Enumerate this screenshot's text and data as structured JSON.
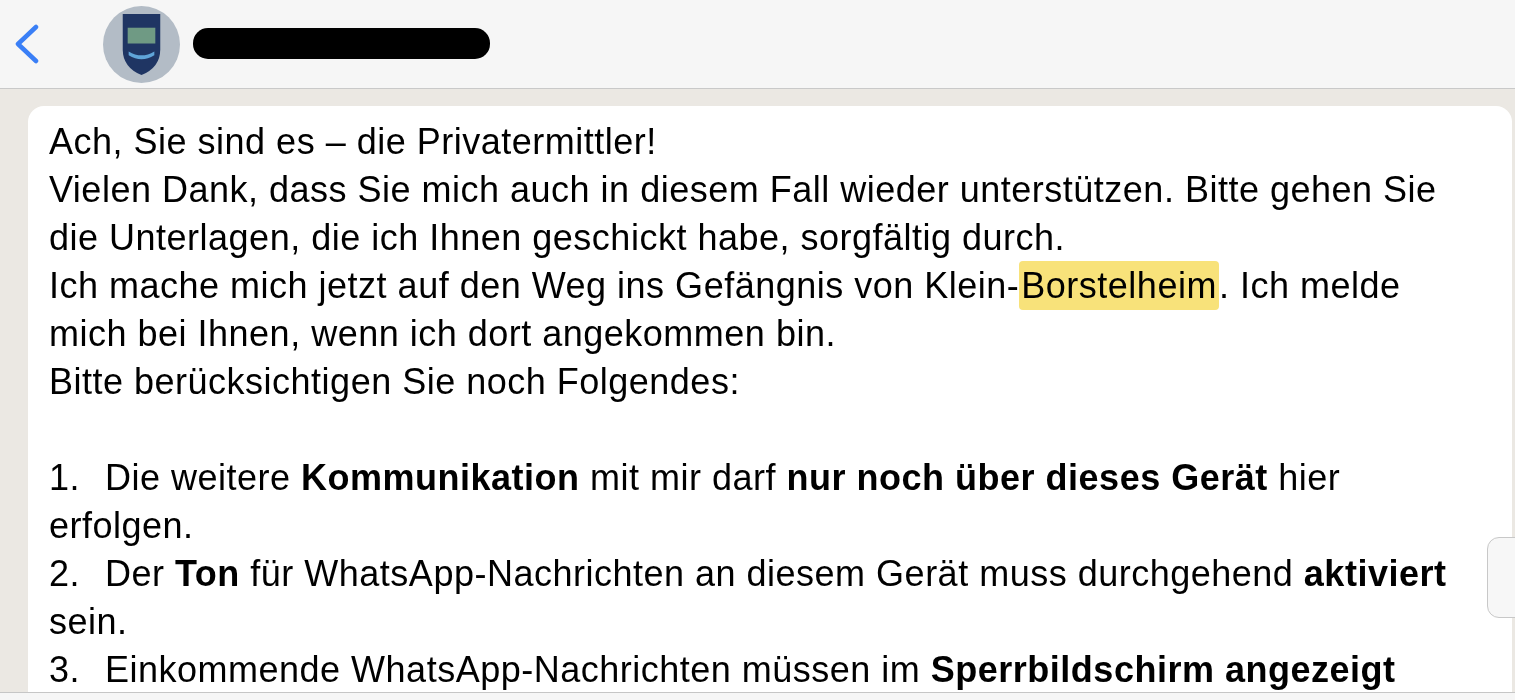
{
  "header": {
    "contact_name": {
      "redacted": true
    }
  },
  "message": {
    "paragraphs": [
      {
        "segments": [
          {
            "text": "Ach, Sie sind es – die Privatermittler!",
            "highlighted": false
          }
        ]
      },
      {
        "segments": [
          {
            "text": "Vielen Dank, dass Sie mich auch in diesem Fall wieder unterstützen. Bitte gehen Sie die Unterlagen, die ich Ihnen geschickt habe, sorgfältig durch.",
            "highlighted": false
          }
        ]
      },
      {
        "segments": [
          {
            "text": "Ich mache mich jetzt auf den Weg ins Gefängnis von Klein-",
            "highlighted": false
          },
          {
            "text": "Borstelheim",
            "highlighted": true
          },
          {
            "text": ". Ich melde mich bei Ihnen, wenn ich dort angekommen bin.",
            "highlighted": false
          }
        ]
      },
      {
        "segments": [
          {
            "text": "Bitte berücksichtigen Sie noch Folgendes:",
            "highlighted": false
          }
        ]
      }
    ],
    "list": [
      {
        "number": "1.",
        "text": "Die weitere **Kommunikation** mit mir darf **nur noch über dieses Gerät** hier erfolgen."
      },
      {
        "number": "2.",
        "text": "Der **Ton** für WhatsApp-Nachrichten an diesem Gerät muss durchgehend **aktiviert** sein."
      },
      {
        "number": "3.",
        "text": "Einkommende WhatsApp-Nachrichten müssen im **Sperrbildschirm angezeigt**"
      }
    ]
  }
}
